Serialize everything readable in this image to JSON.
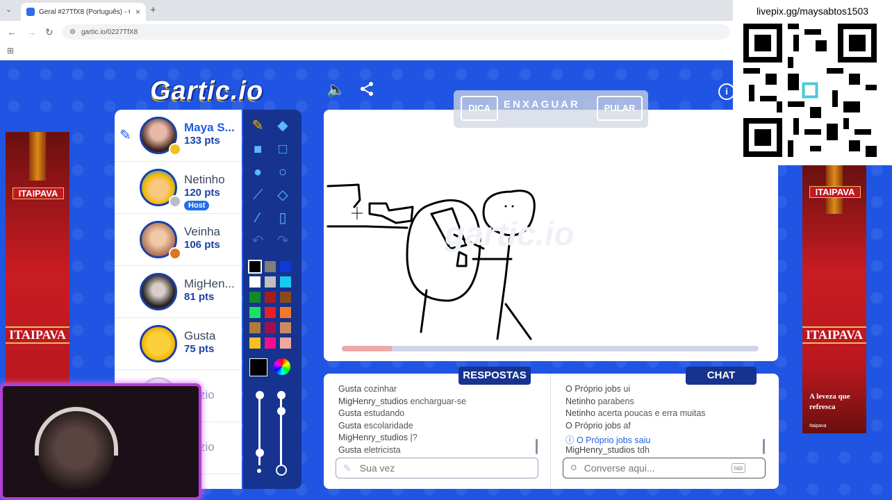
{
  "browser": {
    "tab_title": "Geral #27TfX8 (Português) - Ga",
    "url": "gartic.io/0227TfX8",
    "new_tab": "+",
    "tab_close": "×"
  },
  "game": {
    "logo": "Gartic.io",
    "hint_button": "DICA",
    "word": "ENXAGUAR",
    "skip_button": "PULAR",
    "timer_progress": 0.12,
    "watermark": "gartic.io"
  },
  "players": [
    {
      "name": "Maya S...",
      "points": "133 pts",
      "status_color": "#f2c21b",
      "drawing": true
    },
    {
      "name": "Netinho",
      "points": "120 pts",
      "status_color": "#b8bcc6",
      "badge": "Host"
    },
    {
      "name": "Veinha",
      "points": "106 pts",
      "status_color": "#e0751f"
    },
    {
      "name": "MigHen...",
      "points": "81 pts"
    },
    {
      "name": "Gusta",
      "points": "75 pts"
    },
    {
      "name": "zio"
    },
    {
      "name": "zio"
    }
  ],
  "palette": [
    "#000000",
    "#7f7f7f",
    "#1039d8",
    "#ffffff",
    "#bfbfbf",
    "#18c9f0",
    "#138a2a",
    "#a81c1c",
    "#8a4a1a",
    "#1fe060",
    "#ee1c24",
    "#f07b2a",
    "#b07a3a",
    "#a01050",
    "#c88a60",
    "#f8c020",
    "#f01090",
    "#f0a8a0"
  ],
  "answers": {
    "title": "RESPOSTAS",
    "messages": [
      {
        "user": "Gusta",
        "text": "cozinhar"
      },
      {
        "user": "MigHenry_studios",
        "text": "encharguar-se"
      },
      {
        "user": "Gusta",
        "text": "estudando"
      },
      {
        "user": "Gusta",
        "text": "escolaridade"
      },
      {
        "user": "MigHenry_studios",
        "text": "|?"
      },
      {
        "user": "Gusta",
        "text": "eletricista"
      }
    ],
    "placeholder": "Sua vez"
  },
  "chat": {
    "title": "CHAT",
    "messages": [
      {
        "user": "O Próprio jobs",
        "text": "ui"
      },
      {
        "user": "Netinho",
        "text": "parabens"
      },
      {
        "user": "Netinho",
        "text": "acerta poucas e erra muitas"
      },
      {
        "user": "O Próprio jobs",
        "text": "af"
      },
      {
        "user": "O Próprio jobs",
        "text": "saiu",
        "system": true
      },
      {
        "user": "MigHenry_studios",
        "text": "tdh"
      }
    ],
    "placeholder": "Converse aqui...",
    "tab_key": "tab"
  },
  "ads": {
    "brand": "ITAIPAVA",
    "slogan": "A leveza que refresca",
    "small": "Itaipava"
  },
  "donation": {
    "text": "livepix.gg/maysabtos1503"
  },
  "icons": {
    "sound": "speaker-icon",
    "share": "share-icon",
    "info": "info-icon"
  }
}
